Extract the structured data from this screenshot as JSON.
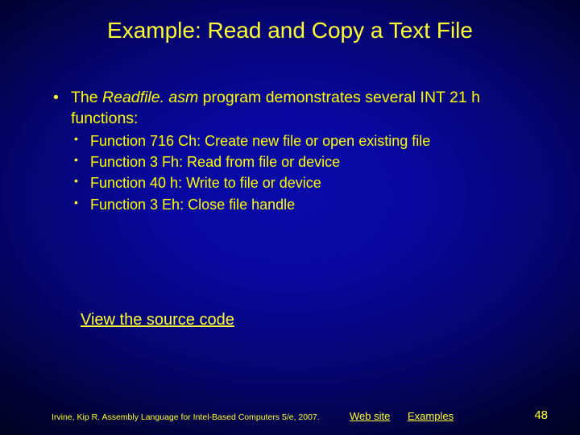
{
  "title": "Example: Read and Copy a Text File",
  "intro_a": "The ",
  "intro_italic": "Readfile. asm",
  "intro_b": " program demonstrates several INT 21 h functions:",
  "items": [
    "Function 716 Ch: Create new file or open existing file",
    "Function 3 Fh: Read from file or device",
    "Function 40 h: Write to file or device",
    "Function 3 Eh: Close file handle"
  ],
  "source_link": "View the source code",
  "footer": {
    "copyright": "Irvine, Kip R. Assembly Language for Intel-Based Computers 5/e, 2007.",
    "website": "Web site",
    "examples": "Examples",
    "page": "48"
  }
}
